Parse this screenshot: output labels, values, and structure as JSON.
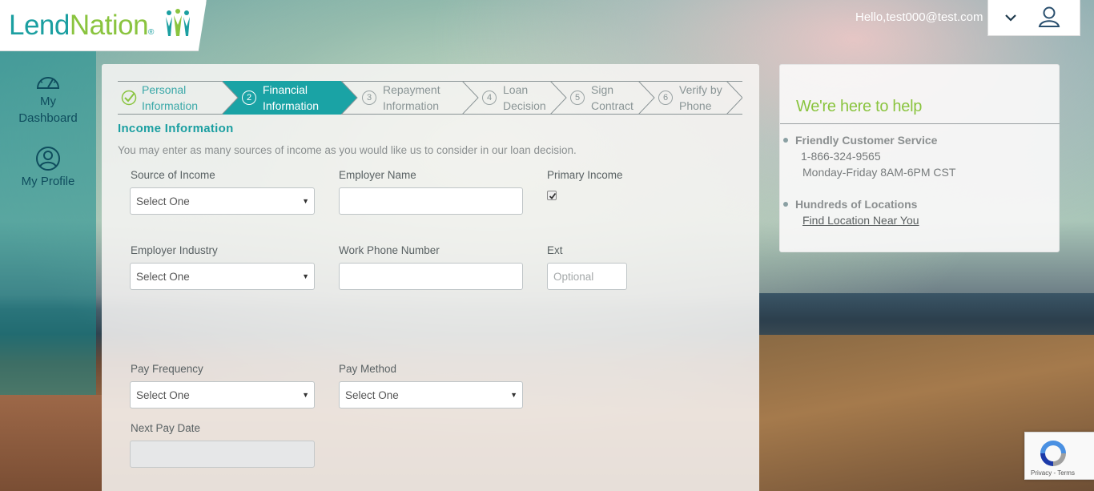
{
  "brand": {
    "logo_part1": "Lend",
    "logo_part2": "Nation",
    "registered": "®"
  },
  "header": {
    "greeting": "Hello,test000@test.com"
  },
  "sidebar": {
    "items": [
      {
        "label_line1": "My",
        "label_line2": "Dashboard",
        "icon": "gauge-icon"
      },
      {
        "label_line1": "My Profile",
        "label_line2": "",
        "icon": "user-circle-icon"
      }
    ]
  },
  "stepper": {
    "steps": [
      {
        "number": "1",
        "line1": "Personal",
        "line2": "Information",
        "state": "done"
      },
      {
        "number": "2",
        "line1": "Financial",
        "line2": "Information",
        "state": "active"
      },
      {
        "number": "3",
        "line1": "Repayment",
        "line2": "Information",
        "state": "upcoming"
      },
      {
        "number": "4",
        "line1": "Loan",
        "line2": "Decision",
        "state": "upcoming"
      },
      {
        "number": "5",
        "line1": "Sign",
        "line2": "Contract",
        "state": "upcoming"
      },
      {
        "number": "6",
        "line1": "Verify by",
        "line2": "Phone",
        "state": "upcoming"
      }
    ]
  },
  "form": {
    "title": "Income Information",
    "intro": "You may enter as many sources of income as you would like us to consider in our loan decision.",
    "source_of_income": {
      "label": "Source of Income",
      "value": "Select One"
    },
    "employer_name": {
      "label": "Employer Name",
      "value": ""
    },
    "primary_income": {
      "label": "Primary Income",
      "checked": true
    },
    "employer_industry": {
      "label": "Employer Industry",
      "value": "Select One"
    },
    "work_phone": {
      "label": "Work Phone Number",
      "value": ""
    },
    "ext": {
      "label": "Ext",
      "placeholder": "Optional"
    },
    "pay_frequency": {
      "label": "Pay Frequency",
      "value": "Select One"
    },
    "pay_method": {
      "label": "Pay Method",
      "value": "Select One"
    },
    "next_pay_date": {
      "label": "Next Pay Date",
      "value": ""
    }
  },
  "help": {
    "title": "We're here to help",
    "service_heading": "Friendly Customer Service",
    "phone": "1-866-324-9565",
    "hours": "Monday-Friday 8AM-6PM CST",
    "locations_heading": "Hundreds of Locations",
    "locations_link": "Find Location Near You"
  },
  "recaptcha": {
    "links": "Privacy - Terms"
  },
  "colors": {
    "teal": "#1b9fa1",
    "green": "#8ac43f",
    "active_step": "#1aa3a5"
  }
}
